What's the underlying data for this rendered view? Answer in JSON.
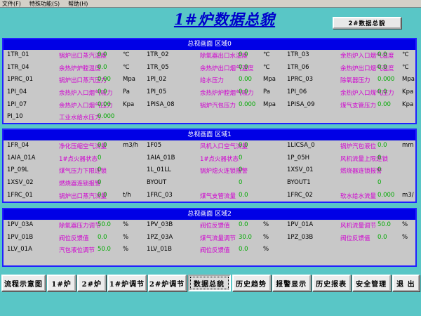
{
  "menu": [
    "文件(F)",
    "特殊功能(S)",
    "帮助(H)"
  ],
  "title": "1#炉数据总貌",
  "top_button": "2#数据总貌",
  "colors": {
    "background": "#59c6c6",
    "panel": "#c8c8c8",
    "header": "#0000e6",
    "desc": "#d000d0",
    "value": "#00aa00"
  },
  "panels": [
    {
      "header": "总视画面 区域0",
      "rows": [
        [
          [
            "1TR_01",
            "锅炉出口蒸汽温度",
            "0.0",
            "℃"
          ],
          [
            "1TR_02",
            "除氧器出口水温度",
            "0.0",
            "℃"
          ],
          [
            "1TR_03",
            "余热炉入口烟气温度",
            "0.0",
            "℃"
          ]
        ],
        [
          [
            "1TR_04",
            "余热炉炉膛温度",
            "0.0",
            "℃"
          ],
          [
            "1TR_05",
            "余热炉出口烟气温度",
            "0.0",
            "℃"
          ],
          [
            "1TR_06",
            "余热炉出口烟气温度",
            "0.0",
            "℃"
          ]
        ],
        [
          [
            "1PRC_01",
            "锅炉出口蒸汽压力",
            "0.00",
            "Mpa"
          ],
          [
            "1PI_02",
            "给水压力",
            "0.00",
            "Mpa"
          ],
          [
            "1PRC_03",
            "除氧器压力",
            "0.000",
            "Mpa"
          ]
        ],
        [
          [
            "1PI_04",
            "余热炉入口烟气吸力",
            "0.0",
            "Pa"
          ],
          [
            "1PI_05",
            "余热炉炉膛烟气吸力",
            "0.0",
            "Pa"
          ],
          [
            "1PI_06",
            "余热炉入口煤气压力",
            "0.0",
            "Kpa"
          ]
        ],
        [
          [
            "1PI_07",
            "余热炉入口烟气压力",
            "0.00",
            "Kpa"
          ],
          [
            "1PISA_08",
            "锅炉汽包压力",
            "0.000",
            "Mpa"
          ],
          [
            "1PISA_09",
            "煤气支管压力",
            "0.00",
            "Kpa"
          ]
        ],
        [
          [
            "PI_10",
            "工业水给水压力",
            "0.000",
            ""
          ]
        ]
      ]
    },
    {
      "header": "总视画面 区域1",
      "rows": [
        [
          [
            "1FR_04",
            "净化压缩空气流量",
            "0.0",
            "m3/h"
          ],
          [
            "1F05",
            "风机入口空气流量",
            "0.0",
            ""
          ],
          [
            "1LICSA_0",
            "锅炉汽包液位",
            "0.0",
            "mm"
          ]
        ],
        [
          [
            "1AIA_01A",
            "1#点火器状态",
            "0",
            ""
          ],
          [
            "1AIA_01B",
            "1#点火器状态",
            "0",
            ""
          ],
          [
            "1P_05H",
            "风机流量上限连锁",
            "0",
            ""
          ]
        ],
        [
          [
            "1P_09L",
            "煤气压力下限连锁",
            "0",
            ""
          ],
          [
            "1L_01LL",
            "锅炉熄火连锁报警",
            "0",
            ""
          ],
          [
            "1XSV_01",
            "燃烧器连锁报警",
            "0",
            ""
          ]
        ],
        [
          [
            "1XSV_02",
            "燃烧器连锁报警",
            "0",
            ""
          ],
          [
            "BYOUT",
            "",
            "0",
            ""
          ],
          [
            "BYOUT1",
            "",
            "0",
            ""
          ]
        ],
        [
          [
            "1FRC_01",
            "锅炉出口蒸汽流量",
            "0.0",
            "t/h"
          ],
          [
            "1FRC_03",
            "煤气支管流量",
            "0.0",
            ""
          ],
          [
            "1FRC_02",
            "软水给水流量",
            "0.000",
            "m3/"
          ]
        ]
      ]
    },
    {
      "header": "总视画面 区域2",
      "rows": [
        [
          [
            "1PV_03A",
            "除氧器压力调节",
            "50.0",
            "%"
          ],
          [
            "1PV_03B",
            "阀位反馈值",
            "0.0",
            "%"
          ],
          [
            "1PV_01A",
            "风机流量调节",
            "50.0",
            "%"
          ]
        ],
        [
          [
            "1PV_01B",
            "阀位反馈值",
            "0.0",
            "%"
          ],
          [
            "1PZ_03A",
            "煤气流量调节",
            "30.0",
            "%"
          ],
          [
            "1PZ_03B",
            "阀位反馈值",
            "0.0",
            "%"
          ]
        ],
        [
          [
            "1LV_01A",
            "汽包液位调节",
            "50.0",
            "%"
          ],
          [
            "1LV_01B",
            "阀位反馈值",
            "0.0",
            "%"
          ]
        ]
      ]
    }
  ],
  "nav": [
    {
      "label": "流程示意图",
      "active": false
    },
    {
      "label": "1#炉",
      "active": false
    },
    {
      "label": "2#炉",
      "active": false
    },
    {
      "label": "1#炉调节",
      "active": false
    },
    {
      "label": "2#炉调节",
      "active": false
    },
    {
      "label": "数据总貌",
      "active": true
    },
    {
      "label": "历史趋势",
      "active": false
    },
    {
      "label": "报警显示",
      "active": false
    },
    {
      "label": "历史报表",
      "active": false
    },
    {
      "label": "安全管理",
      "active": false
    },
    {
      "label": "退 出",
      "active": false
    }
  ]
}
